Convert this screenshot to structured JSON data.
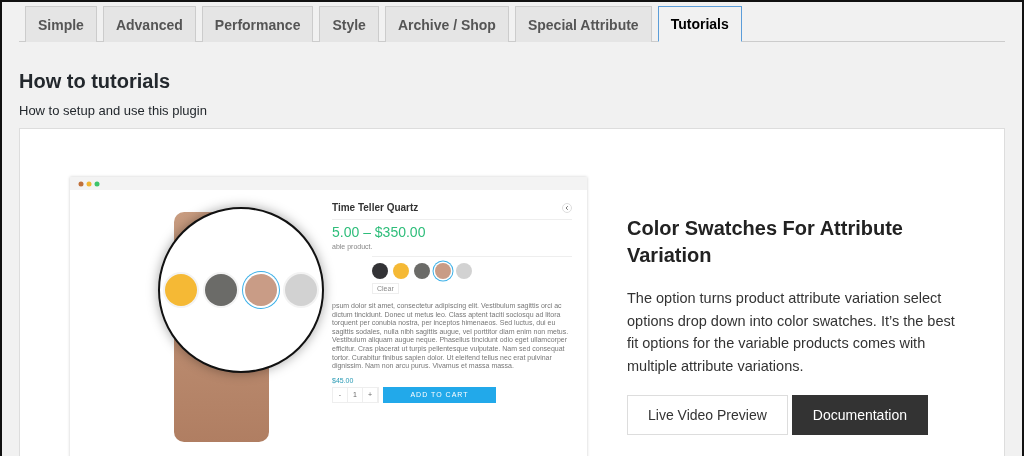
{
  "tabs": [
    {
      "label": "Simple",
      "selected": false
    },
    {
      "label": "Advanced",
      "selected": false
    },
    {
      "label": "Performance",
      "selected": false
    },
    {
      "label": "Style",
      "selected": false
    },
    {
      "label": "Archive / Shop",
      "selected": false
    },
    {
      "label": "Special Attribute",
      "selected": false
    },
    {
      "label": "Tutorials",
      "selected": true
    }
  ],
  "section": {
    "title": "How to tutorials",
    "subtitle": "How to setup and use this plugin"
  },
  "preview": {
    "product_title": "Time Teller Quartz",
    "price_range": "5.00 – $350.00",
    "short_description": "able product.",
    "swatches": [
      {
        "color": "#333336",
        "selected": false
      },
      {
        "color": "#f5b935",
        "selected": false
      },
      {
        "color": "#6b6b68",
        "selected": false
      },
      {
        "color": "#c99c86",
        "selected": true
      },
      {
        "color": "#d2d2d2",
        "selected": false
      }
    ],
    "clear_label": "Clear",
    "description": "psum dolor sit amet, consectetur adipiscing elit. Vestibulum sagittis orci ac dictum tincidunt. Donec ut metus leo. Class aptent taciti sociosqu ad litora torquent per conubia nostra, per inceptos himenaeos. Sed luctus, dui eu sagittis sodales, nulla nibh sagittis augue, vel porttitor diam enim non metus. Vestibulum aliquam augue neque. Phasellus tincidunt odio eget ullamcorper efficitur. Cras placerat ut turpis pellentesque vulputate. Nam sed consequat tortor. Curabitur finibus sapien dolor. Ut eleifend tellus nec erat pulvinar dignissim. Nam non arcu purus. Vivamus et massa massa.",
    "price": "$45.00",
    "quantity": "1",
    "minus": "-",
    "plus": "+",
    "add_to_cart": "ADD TO CART"
  },
  "feature": {
    "title": "Color Swatches For Attribute Variation",
    "description": "The option turns product attribute variation select options drop down into color swatches. It’s the best fit options for the variable products comes with multiple attribute variations.",
    "buttons": [
      {
        "label": "Live Video Preview",
        "kind": "outline"
      },
      {
        "label": "Documentation",
        "kind": "dark"
      }
    ]
  }
}
